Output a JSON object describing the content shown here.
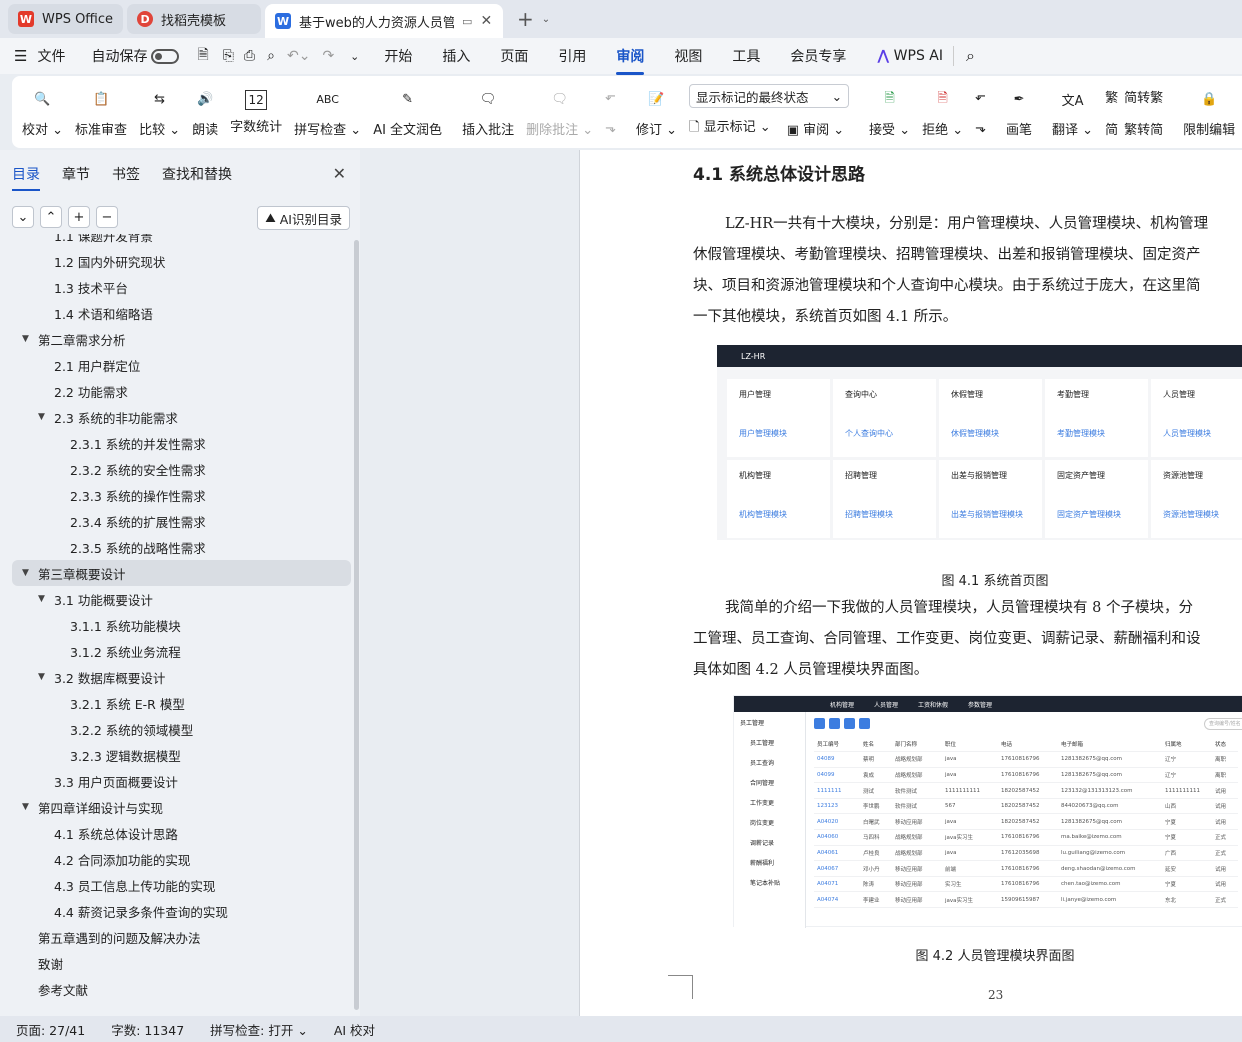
{
  "tabs": [
    {
      "label": "WPS Office",
      "icon": "wps-logo"
    },
    {
      "label": "找稻壳模板",
      "icon": "docer-logo"
    },
    {
      "label": "基于web的人力资源人员管理",
      "icon": "word-logo"
    }
  ],
  "menu": {
    "items": [
      "文件",
      "自动保存"
    ],
    "main_tabs": [
      "开始",
      "插入",
      "页面",
      "引用",
      "审阅",
      "视图",
      "工具",
      "会员专享"
    ],
    "selected": "审阅",
    "wps_ai": "WPS AI"
  },
  "ribbon": {
    "proof": "校对",
    "std_review": "标准审查",
    "compare": "比较",
    "read": "朗读",
    "word_count": "字数统计",
    "spell": "拼写检查",
    "ai_polish": "AI 全文润色",
    "insert_comment": "插入批注",
    "delete_comment": "删除批注",
    "revise": "修订",
    "show_mode": "显示标记的最终状态",
    "show_markup": "显示标记",
    "review_pane": "审阅",
    "accept": "接受",
    "reject": "拒绝",
    "pen": "画笔",
    "translate": "翻译",
    "to_trad": "简转繁",
    "to_simp": "繁转简",
    "restrict_edit": "限制编辑",
    "doc_more": "文档"
  },
  "sidebar": {
    "tabs": [
      "目录",
      "章节",
      "书签",
      "查找和替换"
    ],
    "ai_toc": "AI识别目录",
    "toc": [
      {
        "level": 2,
        "text": "1.1 课题开发背景",
        "arrow": ""
      },
      {
        "level": 2,
        "text": "1.2 国内外研究现状",
        "arrow": ""
      },
      {
        "level": 2,
        "text": "1.3 技术平台",
        "arrow": ""
      },
      {
        "level": 2,
        "text": "1.4 术语和缩略语",
        "arrow": ""
      },
      {
        "level": 1,
        "text": "第二章需求分析",
        "arrow": "▼"
      },
      {
        "level": 2,
        "text": "2.1 用户群定位",
        "arrow": ""
      },
      {
        "level": 2,
        "text": "2.2 功能需求",
        "arrow": ""
      },
      {
        "level": 2,
        "text": "2.3 系统的非功能需求",
        "arrow": "▼"
      },
      {
        "level": 3,
        "text": "2.3.1 系统的并发性需求",
        "arrow": ""
      },
      {
        "level": 3,
        "text": "2.3.2 系统的安全性需求",
        "arrow": ""
      },
      {
        "level": 3,
        "text": "2.3.3 系统的操作性需求",
        "arrow": ""
      },
      {
        "level": 3,
        "text": "2.3.4 系统的扩展性需求",
        "arrow": ""
      },
      {
        "level": 3,
        "text": "2.3.5 系统的战略性需求",
        "arrow": ""
      },
      {
        "level": 1,
        "text": "第三章概要设计",
        "arrow": "▼",
        "selected": true
      },
      {
        "level": 2,
        "text": "3.1 功能概要设计",
        "arrow": "▼"
      },
      {
        "level": 3,
        "text": "3.1.1 系统功能模块",
        "arrow": ""
      },
      {
        "level": 3,
        "text": "3.1.2 系统业务流程",
        "arrow": ""
      },
      {
        "level": 2,
        "text": "3.2 数据库概要设计",
        "arrow": "▼"
      },
      {
        "level": 3,
        "text": "3.2.1 系统 E-R 模型",
        "arrow": ""
      },
      {
        "level": 3,
        "text": "3.2.2 系统的领域模型",
        "arrow": ""
      },
      {
        "level": 3,
        "text": "3.2.3 逻辑数据模型",
        "arrow": ""
      },
      {
        "level": 2,
        "text": "3.3 用户页面概要设计",
        "arrow": ""
      },
      {
        "level": 1,
        "text": "第四章详细设计与实现",
        "arrow": "▼"
      },
      {
        "level": 2,
        "text": "4.1 系统总体设计思路",
        "arrow": ""
      },
      {
        "level": 2,
        "text": "4.2 合同添加功能的实现",
        "arrow": ""
      },
      {
        "level": 2,
        "text": "4.3 员工信息上传功能的实现",
        "arrow": ""
      },
      {
        "level": 2,
        "text": "4.4 薪资记录多条件查询的实现",
        "arrow": ""
      },
      {
        "level": 1,
        "text": "第五章遇到的问题及解决办法",
        "arrow": ""
      },
      {
        "level": 1,
        "text": "致谢",
        "arrow": ""
      },
      {
        "level": 1,
        "text": "参考文献",
        "arrow": ""
      }
    ]
  },
  "doc": {
    "heading": "4.1 系统总体设计思路",
    "para1": [
      "LZ-HR一共有十大模块，分别是：用户管理模块、人员管理模块、机构管理",
      "休假管理模块、考勤管理模块、招聘管理模块、出差和报销管理模块、固定资产",
      "块、项目和资源池管理模块和个人查询中心模块。由于系统过于庞大，在这里简",
      "一下其他模块，系统首页如图 4.1 所示。"
    ],
    "fig1": {
      "brand": "LZ-HR",
      "cells": [
        {
          "t": "用户管理",
          "l": "用户管理模块"
        },
        {
          "t": "查询中心",
          "l": "个人查询中心"
        },
        {
          "t": "休假管理",
          "l": "休假管理模块"
        },
        {
          "t": "考勤管理",
          "l": "考勤管理模块"
        },
        {
          "t": "人员管理",
          "l": "人员管理模块"
        },
        {
          "t": "机构管理",
          "l": "机构管理模块"
        },
        {
          "t": "招聘管理",
          "l": "招聘管理模块"
        },
        {
          "t": "出差与报销管理",
          "l": "出差与报销管理模块"
        },
        {
          "t": "固定资产管理",
          "l": "固定资产管理模块"
        },
        {
          "t": "资源池管理",
          "l": "资源池管理模块"
        }
      ],
      "caption": "图 4.1  系统首页图"
    },
    "para2": [
      "我简单的介绍一下我做的人员管理模块，人员管理模块有 8 个子模块，分",
      "工管理、员工查询、合同管理、工作变更、岗位变更、调薪记录、薪酬福利和设",
      "具体如图 4.2 人员管理模块界面图。"
    ],
    "fig2": {
      "nav": [
        "机构管理",
        "人员管理",
        "工资和休假",
        "参数管理"
      ],
      "side": [
        "员工管理",
        "员工管理",
        "员工查询",
        "合同管理",
        "工作变更",
        "岗位变更",
        "调薪记录",
        "薪酬福利",
        "笔记本补贴"
      ],
      "search": "查询编号/姓名",
      "headers": [
        "员工编号",
        "姓名",
        "部门名称",
        "职位",
        "电话",
        "电子邮箱",
        "归属地",
        "状态"
      ],
      "rows": [
        [
          "04089",
          "蔡明",
          "战略规划部",
          "java",
          "17610816796",
          "1281382675@qq.com",
          "辽宁",
          "离职"
        ],
        [
          "04099",
          "袁成",
          "战略规划部",
          "java",
          "17610816796",
          "1281382675@qq.com",
          "辽宁",
          "离职"
        ],
        [
          "1111111",
          "测试",
          "软件测试",
          "1111111111",
          "18202587452",
          "123132@131313123.com",
          "1111111111",
          "试用"
        ],
        [
          "123123",
          "李世鹏",
          "软件测试",
          "567",
          "18202587452",
          "844020673@qq.com",
          "山西",
          "试用"
        ],
        [
          "A04020",
          "白曙武",
          "移动应用部",
          "java",
          "18202587452",
          "1281382675@qq.com",
          "宁夏",
          "试用"
        ],
        [
          "A04060",
          "马四科",
          "战略规划部",
          "java实习生",
          "17610816796",
          "ma.baike@izemo.com",
          "宁夏",
          "正式"
        ],
        [
          "A04061",
          "卢桂良",
          "战略规划部",
          "java",
          "17612035698",
          "lu.guiliang@izemo.com",
          "广西",
          "正式"
        ],
        [
          "A04067",
          "邓小丹",
          "移动应用部",
          "前端",
          "17610816796",
          "deng.shaodan@izemo.com",
          "延安",
          "试用"
        ],
        [
          "A04071",
          "陈涛",
          "移动应用部",
          "实习生",
          "17610816796",
          "chen.tao@izemo.com",
          "宁夏",
          "试用"
        ],
        [
          "A04074",
          "李建业",
          "移动应用部",
          "java实习生",
          "15909615987",
          "li.janye@izemo.com",
          "东北",
          "正式"
        ]
      ],
      "caption": "图 4.2  人员管理模块界面图"
    },
    "page_number": "23"
  },
  "status": {
    "page": "页面: 27/41",
    "words": "字数: 11347",
    "spell": "拼写检查: 打开",
    "ai": "AI 校对"
  },
  "colors": {
    "accent": "#1a55c8",
    "link": "#3d7de0",
    "wps_red": "#e33a2b",
    "word_blue": "#2b6de0"
  }
}
